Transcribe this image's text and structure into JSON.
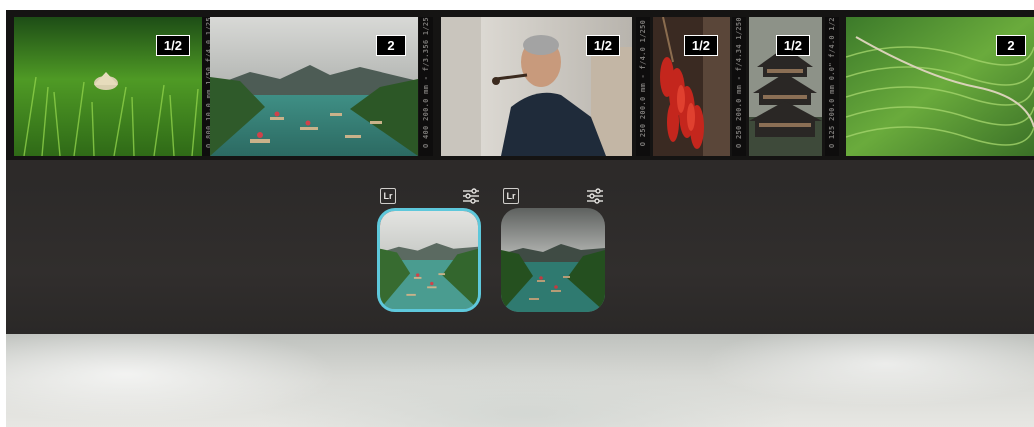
{
  "filmstrip": {
    "thumbnails": [
      {
        "label": "rice-field-farmer",
        "badge": "1/2",
        "selected": false
      },
      {
        "label": "river-boats",
        "badge": "2",
        "selected": true
      },
      {
        "label": "old-man-smoking-pipe",
        "badge": "1/2",
        "selected": false
      },
      {
        "label": "red-chili-peppers",
        "badge": "1/2",
        "selected": false
      },
      {
        "label": "wooden-pagoda",
        "badge": "1/2",
        "selected": false
      },
      {
        "label": "terraced-hills",
        "badge": "2",
        "selected": false
      }
    ],
    "sprocket_texts": [
      "O 800 10.0 mm 1/50 f/4.0 1/250",
      "O 400 200.0 mm - f/3.356 1/250",
      "O 250 200.0 mm - f/4.0 1/250",
      "O 250 200.0 mm - f/4.34 1/250",
      "O 125 200.0 mm 0.0\" f/4.0 1/250"
    ]
  },
  "variants": [
    {
      "source_badge": "Lr",
      "active": true,
      "icon": "sliders-icon"
    },
    {
      "source_badge": "Lr",
      "active": false,
      "icon": "sliders-icon"
    }
  ],
  "colors": {
    "accent": "#5ec8db",
    "panel": "#2b2928",
    "filmstrip": "#151413"
  }
}
